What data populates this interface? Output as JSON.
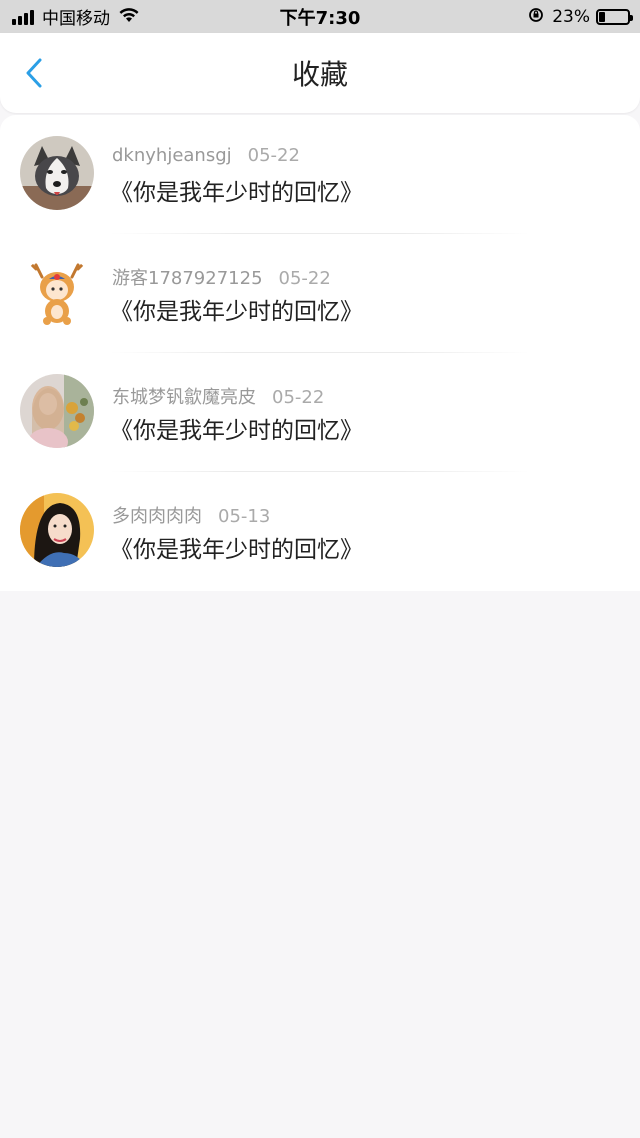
{
  "status_bar": {
    "carrier": "中国移动",
    "time": "下午7:30",
    "battery_percent": "23%",
    "battery_level": 0.23
  },
  "nav": {
    "back_icon": "chevron-left-icon",
    "title": "收藏"
  },
  "colors": {
    "accent": "#2b9fe6",
    "status_bar_bg": "#d9d9d9",
    "page_bg": "#f7f6f8"
  },
  "favorites": [
    {
      "username": "dknyhjeansgj",
      "date": "05-22",
      "title": "《你是我年少时的回忆》",
      "avatar": "husky-dog-avatar"
    },
    {
      "username": "游客1787927125",
      "date": "05-22",
      "title": "《你是我年少时的回忆》",
      "avatar": "cartoon-deer-avatar"
    },
    {
      "username": "东城梦钒歙魔亮皮",
      "date": "05-22",
      "title": "《你是我年少时的回忆》",
      "avatar": "woman-flowers-avatar"
    },
    {
      "username": "多肉肉肉肉",
      "date": "05-13",
      "title": "《你是我年少时的回忆》",
      "avatar": "woman-portrait-avatar"
    }
  ]
}
